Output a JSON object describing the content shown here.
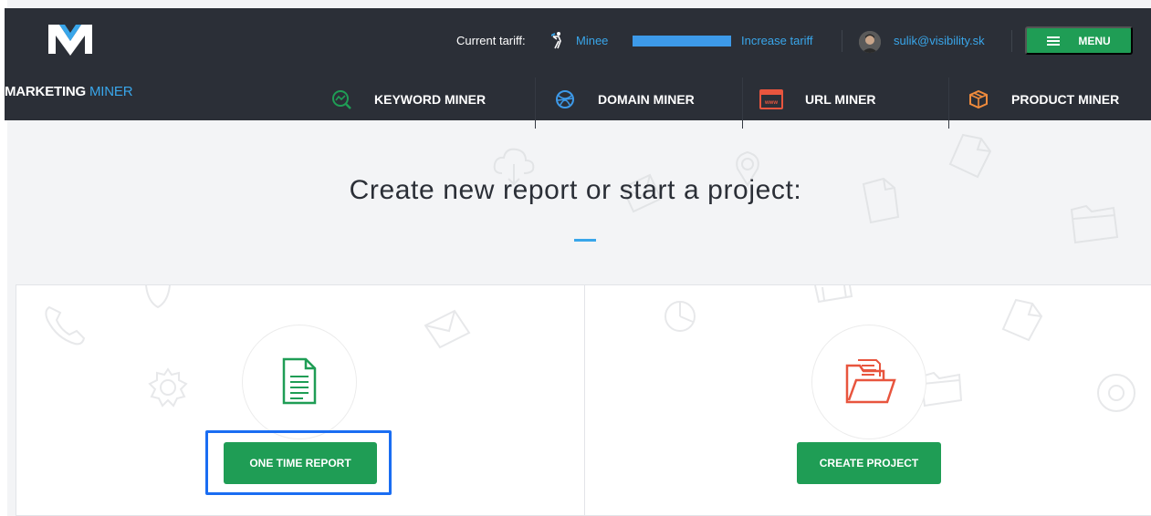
{
  "brand": {
    "name_primary": "MARKETING",
    "name_accent": "MINER"
  },
  "topbar": {
    "tariff_label": "Current tariff:",
    "tariff_name": "Minee",
    "tariff_progress": 1.0,
    "increase_link": "Increase tariff",
    "user_email": "sulik@visibility.sk",
    "menu_label": "MENU"
  },
  "nav": [
    {
      "label": "KEYWORD MINER",
      "icon": "chart-magnifier-icon",
      "color": "#1f9d55"
    },
    {
      "label": "DOMAIN MINER",
      "icon": "globe-icon",
      "color": "#3d9ae9"
    },
    {
      "label": "URL MINER",
      "icon": "browser-www-icon",
      "color": "#e8553e"
    },
    {
      "label": "PRODUCT MINER",
      "icon": "box-icon",
      "color": "#f08b3c"
    }
  ],
  "main": {
    "headline": "Create new report or start a project:",
    "cards": [
      {
        "button": "ONE TIME REPORT",
        "icon": "document-icon",
        "icon_color": "#1f9d55"
      },
      {
        "button": "CREATE PROJECT",
        "icon": "folder-icon",
        "icon_color": "#e8553e"
      }
    ]
  },
  "colors": {
    "header_bg": "#2b2f37",
    "accent_blue": "#39a6ea",
    "button_green": "#1f9d55",
    "highlight": "#1a6df2"
  }
}
